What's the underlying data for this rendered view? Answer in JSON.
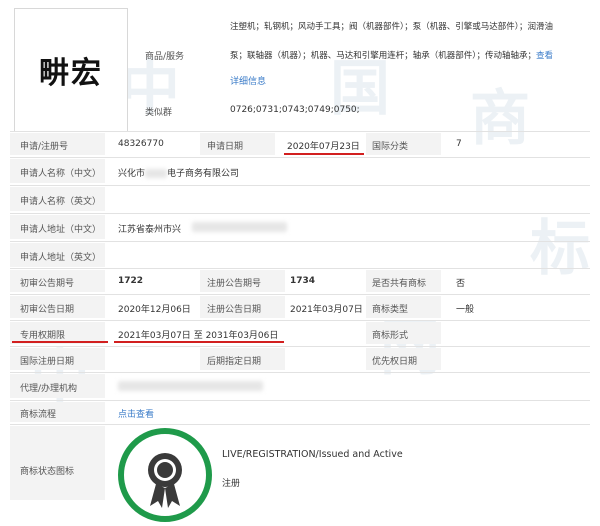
{
  "trademark": {
    "logo_text": "畊宏"
  },
  "goods": {
    "label": "商品/服务",
    "text_line1": "注塑机；轧钢机；风动手工具；阀（机器部件）；泵（机器、引擎或马达部件）；润滑油",
    "text_line2": "泵；联轴器（机器）；机器、马达和引擎用连杆；轴承（机器部件）；传动轴轴承；",
    "more_link": "查看",
    "details_link": "详细信息"
  },
  "similar_group": {
    "label": "类似群",
    "value": "0726;0731;0743;0749;0750;"
  },
  "rows": {
    "reg_no_label": "申请/注册号",
    "reg_no": "48326770",
    "apply_date_label": "申请日期",
    "apply_date": "2020年07月23日",
    "intl_class_label": "国际分类",
    "intl_class": "7",
    "applicant_cn_label": "申请人名称（中文）",
    "applicant_cn_prefix": "兴化市",
    "applicant_cn_suffix": "电子商务有限公司",
    "applicant_en_label": "申请人名称（英文）",
    "address_cn_label": "申请人地址（中文）",
    "address_cn": "江苏省泰州市兴",
    "address_en_label": "申请人地址（英文）",
    "prelim_issue_label": "初审公告期号",
    "prelim_issue": "1722",
    "reg_issue_label": "注册公告期号",
    "reg_issue": "1734",
    "shared_label": "是否共有商标",
    "shared": "否",
    "prelim_date_label": "初审公告日期",
    "prelim_date": "2020年12月06日",
    "reg_date_label": "注册公告日期",
    "reg_date": "2021年03月07日",
    "tm_type_label": "商标类型",
    "tm_type": "一般",
    "exclusive_label": "专用权期限",
    "exclusive_start": "2021年03月07日",
    "exclusive_to": "至",
    "exclusive_end": "2031年03月06日",
    "tm_form_label": "商标形式",
    "intl_reg_date_label": "国际注册日期",
    "later_date_label": "后期指定日期",
    "priority_date_label": "优先权日期",
    "agent_label": "代理/办理机构",
    "process_label": "商标流程",
    "process_link": "点击查看",
    "status_icon_label": "商标状态图标",
    "status_en": "LIVE/REGISTRATION/Issued and Active",
    "status_cn": "注册"
  },
  "colors": {
    "accent_link": "#3a7bc8",
    "underline_red": "#d21f1f",
    "status_green": "#1f9a4a",
    "label_bg": "#f3f3f3"
  },
  "icons": {
    "status_badge": "award-ribbon-icon"
  }
}
